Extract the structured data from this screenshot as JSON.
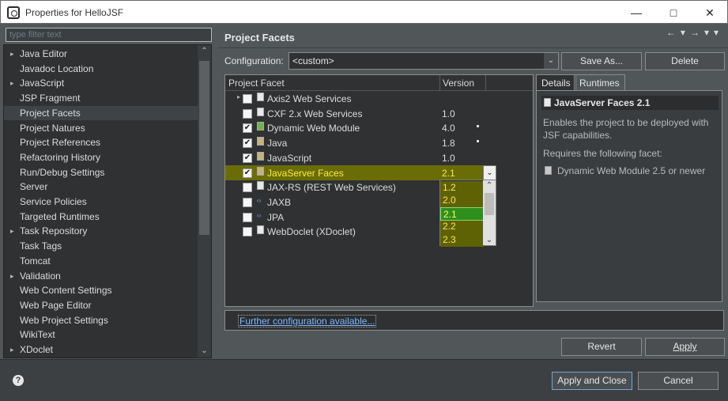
{
  "window": {
    "title": "Properties for HelloJSF"
  },
  "filter": {
    "placeholder": "type filter text"
  },
  "sidebar": {
    "items": [
      {
        "label": "Java Editor",
        "expandable": true
      },
      {
        "label": "Javadoc Location",
        "expandable": false
      },
      {
        "label": "JavaScript",
        "expandable": true
      },
      {
        "label": "JSP Fragment",
        "expandable": false
      },
      {
        "label": "Project Facets",
        "expandable": false,
        "selected": true
      },
      {
        "label": "Project Natures",
        "expandable": false
      },
      {
        "label": "Project References",
        "expandable": false
      },
      {
        "label": "Refactoring History",
        "expandable": false
      },
      {
        "label": "Run/Debug Settings",
        "expandable": false
      },
      {
        "label": "Server",
        "expandable": false
      },
      {
        "label": "Service Policies",
        "expandable": false
      },
      {
        "label": "Targeted Runtimes",
        "expandable": false
      },
      {
        "label": "Task Repository",
        "expandable": true
      },
      {
        "label": "Task Tags",
        "expandable": false
      },
      {
        "label": "Tomcat",
        "expandable": false
      },
      {
        "label": "Validation",
        "expandable": true
      },
      {
        "label": "Web Content Settings",
        "expandable": false
      },
      {
        "label": "Web Page Editor",
        "expandable": false
      },
      {
        "label": "Web Project Settings",
        "expandable": false
      },
      {
        "label": "WikiText",
        "expandable": false
      },
      {
        "label": "XDoclet",
        "expandable": true
      }
    ]
  },
  "page": {
    "title": "Project Facets"
  },
  "configuration": {
    "label": "Configuration:",
    "value": "<custom>",
    "save_as": "Save As...",
    "delete": "Delete"
  },
  "facets": {
    "col_facet": "Project Facet",
    "col_version": "Version",
    "rows": [
      {
        "name": "Axis2 Web Services",
        "version": "",
        "checked": false,
        "expandable": true,
        "icon": "doc-icon"
      },
      {
        "name": "CXF 2.x Web Services",
        "version": "1.0",
        "checked": false,
        "icon": "doc-icon"
      },
      {
        "name": "Dynamic Web Module",
        "version": "4.0",
        "checked": true,
        "icon": "web-module-icon"
      },
      {
        "name": "Java",
        "version": "1.8",
        "checked": true,
        "icon": "java-icon"
      },
      {
        "name": "JavaScript",
        "version": "1.0",
        "checked": true,
        "icon": "javascript-icon"
      },
      {
        "name": "JavaServer Faces",
        "version": "2.1",
        "checked": true,
        "highlighted": true,
        "icon": "jsf-icon"
      },
      {
        "name": "JAX-RS (REST Web Services)",
        "version": "",
        "checked": false,
        "icon": "doc-icon"
      },
      {
        "name": "JAXB",
        "version": "",
        "checked": false,
        "icon": "xml-icon"
      },
      {
        "name": "JPA",
        "version": "",
        "checked": false,
        "icon": "xml-icon"
      },
      {
        "name": "WebDoclet (XDoclet)",
        "version": "",
        "checked": false,
        "icon": "doc-icon"
      }
    ],
    "version_options": [
      "1.2",
      "2.0",
      "2.1",
      "2.2",
      "2.3"
    ],
    "selected_version": "2.1"
  },
  "details": {
    "tab_details": "Details",
    "tab_runtimes": "Runtimes",
    "facet_title": "JavaServer Faces 2.1",
    "description": "Enables the project to be deployed with JSF capabilities.",
    "requires_label": "Requires the following facet:",
    "requirement": "Dynamic Web Module 2.5 or newer"
  },
  "further_link": "Further configuration available...",
  "buttons": {
    "revert": "Revert",
    "apply": "Apply",
    "apply_close": "Apply and Close",
    "cancel": "Cancel"
  },
  "colors": {
    "highlight_bg": "#6a6d06",
    "highlight_text": "#ffeb3b",
    "selected_version_bg": "#2f8f1c",
    "link": "#7fb8ff"
  }
}
